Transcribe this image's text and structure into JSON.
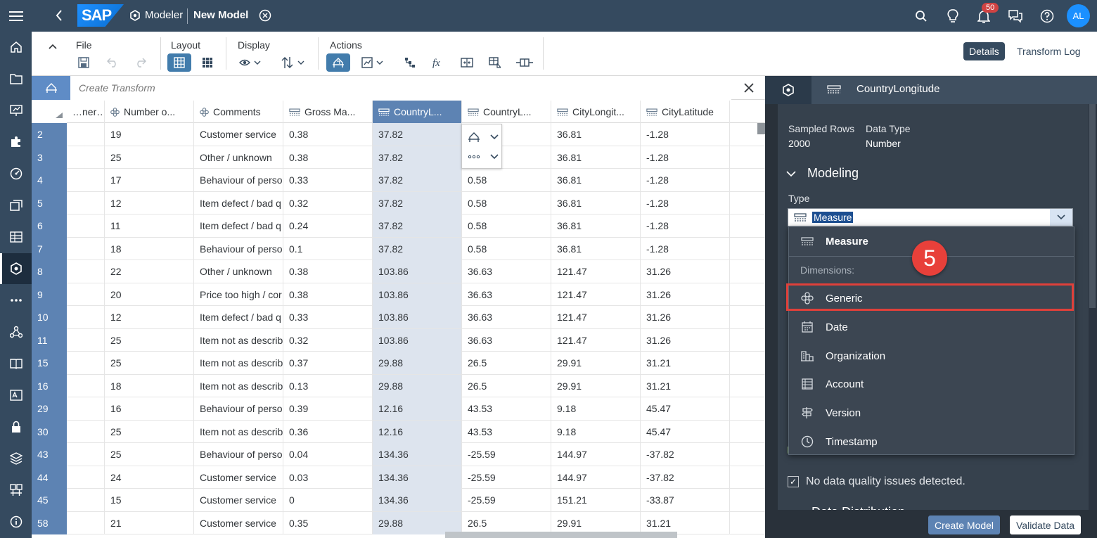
{
  "topbar": {
    "logo_text": "SAP",
    "app_name": "Modeler",
    "model_name": "New Model",
    "notification_count": "50",
    "avatar_initials": "AL"
  },
  "toolbar": {
    "groups": {
      "file": "File",
      "layout": "Layout",
      "display": "Display",
      "actions": "Actions"
    },
    "details_label": "Details",
    "transform_log_label": "Transform Log"
  },
  "transform_bar": {
    "placeholder": "Create Transform"
  },
  "grid": {
    "columns": [
      {
        "label": "…ner…",
        "icon": "none"
      },
      {
        "label": "Number o...",
        "icon": "dimension-icon"
      },
      {
        "label": "Comments",
        "icon": "dimension-icon"
      },
      {
        "label": "Gross Ma...",
        "icon": "measure-icon"
      },
      {
        "label": "CountryL...",
        "icon": "measure-icon",
        "selected": true
      },
      {
        "label": "CountryL...",
        "icon": "measure-icon"
      },
      {
        "label": "CityLongit...",
        "icon": "measure-icon"
      },
      {
        "label": "CityLatitude",
        "icon": "measure-icon"
      }
    ],
    "rows": [
      {
        "n": "2",
        "cells": [
          "",
          "19",
          "Customer service",
          "0.38",
          "37.82",
          "",
          "36.81",
          "-1.28"
        ]
      },
      {
        "n": "3",
        "cells": [
          "",
          "25",
          "Other / unknown",
          "0.38",
          "37.82",
          "",
          "36.81",
          "-1.28"
        ]
      },
      {
        "n": "4",
        "cells": [
          "",
          "17",
          "Behaviour of perso",
          "0.33",
          "37.82",
          "0.58",
          "36.81",
          "-1.28"
        ]
      },
      {
        "n": "5",
        "cells": [
          "",
          "12",
          "Item defect / bad q",
          "0.32",
          "37.82",
          "0.58",
          "36.81",
          "-1.28"
        ]
      },
      {
        "n": "6",
        "cells": [
          "",
          "11",
          "Item defect / bad q",
          "0.24",
          "37.82",
          "0.58",
          "36.81",
          "-1.28"
        ]
      },
      {
        "n": "7",
        "cells": [
          "",
          "18",
          "Behaviour of perso",
          "0.1",
          "37.82",
          "0.58",
          "36.81",
          "-1.28"
        ]
      },
      {
        "n": "8",
        "cells": [
          "",
          "22",
          "Other / unknown",
          "0.38",
          "103.86",
          "36.63",
          "121.47",
          "31.26"
        ]
      },
      {
        "n": "9",
        "cells": [
          "",
          "20",
          "Price too high / cor",
          "0.38",
          "103.86",
          "36.63",
          "121.47",
          "31.26"
        ]
      },
      {
        "n": "10",
        "cells": [
          "",
          "12",
          "Item defect / bad q",
          "0.33",
          "103.86",
          "36.63",
          "121.47",
          "31.26"
        ]
      },
      {
        "n": "11",
        "cells": [
          "",
          "25",
          "Item not as describ",
          "0.32",
          "103.86",
          "36.63",
          "121.47",
          "31.26"
        ]
      },
      {
        "n": "15",
        "cells": [
          "",
          "25",
          "Item not as describ",
          "0.37",
          "29.88",
          "26.5",
          "29.91",
          "31.21"
        ]
      },
      {
        "n": "16",
        "cells": [
          "",
          "18",
          "Item not as describ",
          "0.13",
          "29.88",
          "26.5",
          "29.91",
          "31.21"
        ]
      },
      {
        "n": "29",
        "cells": [
          "",
          "16",
          "Behaviour of perso",
          "0.39",
          "12.16",
          "43.53",
          "9.18",
          "45.47"
        ]
      },
      {
        "n": "30",
        "cells": [
          "",
          "25",
          "Item not as describ",
          "0.36",
          "12.16",
          "43.53",
          "9.18",
          "45.47"
        ]
      },
      {
        "n": "43",
        "cells": [
          "",
          "25",
          "Behaviour of perso",
          "0.04",
          "134.36",
          "-25.59",
          "144.97",
          "-37.82"
        ]
      },
      {
        "n": "44",
        "cells": [
          "",
          "24",
          "Customer service",
          "0.03",
          "134.36",
          "-25.59",
          "144.97",
          "-37.82"
        ]
      },
      {
        "n": "45",
        "cells": [
          "",
          "15",
          "Customer service",
          "0",
          "134.36",
          "-25.59",
          "151.21",
          "-33.87"
        ]
      },
      {
        "n": "58",
        "cells": [
          "",
          "21",
          "Customer service",
          "0.35",
          "29.88",
          "26.5",
          "29.91",
          "31.21"
        ]
      }
    ]
  },
  "details_panel": {
    "title": "CountryLongitude",
    "sampled_rows_label": "Sampled Rows",
    "sampled_rows_value": "2000",
    "data_type_label": "Data Type",
    "data_type_value": "Number",
    "modeling_label": "Modeling",
    "type_label": "Type",
    "type_value": "Measure",
    "dq_message": "No data quality issues detected.",
    "distribution_label": "Data Distribution",
    "create_model_label": "Create Model",
    "validate_data_label": "Validate Data"
  },
  "type_dropdown": {
    "measure_label": "Measure",
    "dimensions_label": "Dimensions:",
    "options": [
      "Generic",
      "Date",
      "Organization",
      "Account",
      "Version",
      "Timestamp"
    ],
    "highlighted": "Generic"
  },
  "step_badge": "5",
  "colors": {
    "shell": "#354a5f",
    "accent": "#5d83b3",
    "highlight_red": "#e0403a",
    "panel_bg": "#36414d"
  }
}
